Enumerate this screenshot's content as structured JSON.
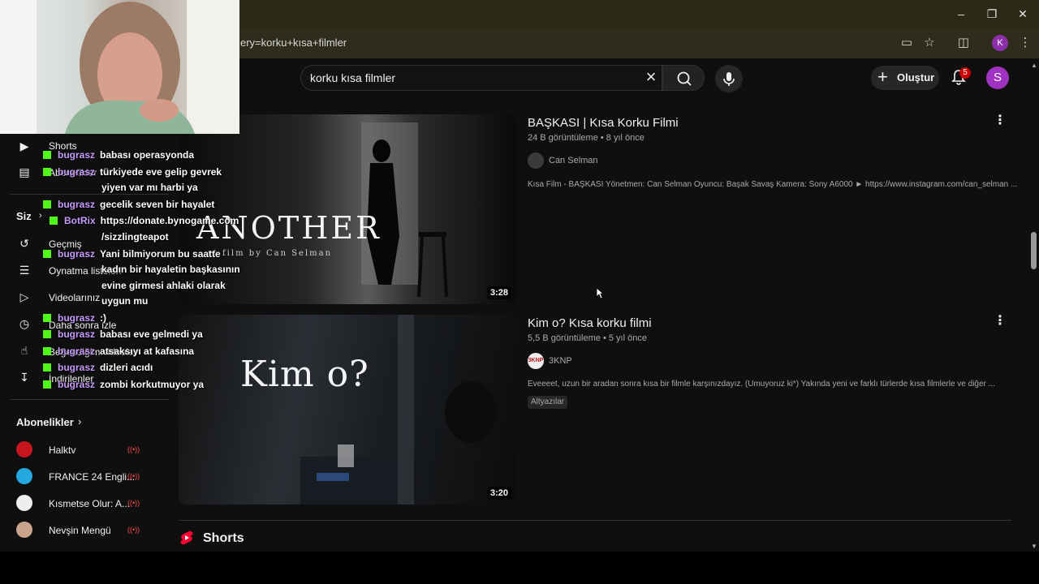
{
  "browser": {
    "url": "ery=korku+kısa+filmler",
    "profile_initial": "K"
  },
  "youtube": {
    "search_value": "korku kısa filmler",
    "create_label": "Oluştur",
    "notification_count": "5",
    "avatar_initial": "S"
  },
  "sidebar": {
    "items": [
      {
        "label": "Shorts",
        "icon": "shorts-icon"
      },
      {
        "label": "Abonelikler",
        "icon": "subscriptions-icon"
      }
    ],
    "you_heading": "Siz",
    "you_items": [
      {
        "label": "Geçmiş",
        "icon": "history-icon"
      },
      {
        "label": "Oynatma listeleri",
        "icon": "playlist-icon"
      },
      {
        "label": "Videolarınız",
        "icon": "your-videos-icon"
      },
      {
        "label": "Daha sonra izle",
        "icon": "watch-later-icon"
      },
      {
        "label": "Beğendiğim videolar",
        "icon": "like-icon"
      },
      {
        "label": "İndirilenler",
        "icon": "download-icon"
      }
    ],
    "subscriptions_heading": "Abonelikler",
    "subscriptions": [
      {
        "name": "Halktv",
        "color": "#c4161c"
      },
      {
        "name": "FRANCE 24 Engli...",
        "color": "#25a8e0"
      },
      {
        "name": "Kısmetse Olur: A...",
        "color": "#eeeeee"
      },
      {
        "name": "Nevşin Mengü",
        "color": "#c9a38a"
      }
    ]
  },
  "videos": [
    {
      "title": "BAŞKASI | Kısa Korku Filmi",
      "meta": "24 B görüntüleme • 8 yıl önce",
      "channel": "Can Selman",
      "description": "Kısa Film - BAŞKASI Yönetmen: Can Selman Oyuncu: Başak Savaş Kamera: Sony A6000 ► https://www.instagram.com/can_selman ...",
      "duration": "3:28",
      "thumb_title": "ANOTHER",
      "thumb_subtitle": "rt film by Can Selman"
    },
    {
      "title": "Kim o? Kısa korku filmi",
      "meta": "5,5 B görüntüleme • 5 yıl önce",
      "channel": "3KNP",
      "channel_logo": "3KNP",
      "description": "Eveeeet, uzun bir aradan sonra kısa bir filmle karşınızdayız. (Umuyoruz ki*) Yakında yeni ve farklı türlerde kısa filmlerle ve diğer ...",
      "chip": "Altyazılar",
      "duration": "3:20",
      "thumb_title": "Kim o?"
    }
  ],
  "shorts_heading": "Shorts",
  "chat": [
    {
      "user": "bugrasz",
      "text": "babası operasyonda"
    },
    {
      "user": "bugrasz",
      "text": "türkiyede eve gelip gevrek"
    },
    {
      "user": "",
      "text": "yiyen var mı harbi ya"
    },
    {
      "user": "bugrasz",
      "text": "gecelik seven bir hayalet"
    },
    {
      "user": "BotRix",
      "text": "https://donate.bynogame.com"
    },
    {
      "user": "",
      "text": "/sizzlingteapot"
    },
    {
      "user": "bugrasz",
      "text": "Yani bilmiyorum bu saatte"
    },
    {
      "user": "",
      "text": "kadın bir hayaletin başkasının"
    },
    {
      "user": "",
      "text": "evine girmesi ahlaki olarak"
    },
    {
      "user": "",
      "text": "uygun mu"
    },
    {
      "user": "bugrasz",
      "text": ":)"
    },
    {
      "user": "bugrasz",
      "text": "babası eve gelmedi ya"
    },
    {
      "user": "bugrasz",
      "text": "atsaksıyı at kafasına"
    },
    {
      "user": "bugrasz",
      "text": "dizleri acıdı"
    },
    {
      "user": "bugrasz",
      "text": "zombi korkutmuyor ya"
    }
  ]
}
